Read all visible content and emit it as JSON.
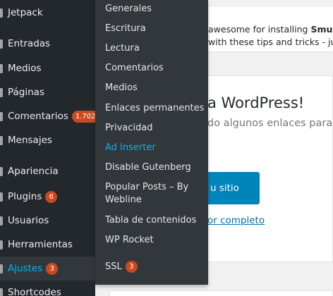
{
  "menu": {
    "items": [
      {
        "label": "Jetpack",
        "icon": "jetpack-icon"
      },
      {
        "label": "Entradas",
        "icon": "pin-icon"
      },
      {
        "label": "Medios",
        "icon": "media-icon"
      },
      {
        "label": "Páginas",
        "icon": "page-icon"
      },
      {
        "label": "Comentarios",
        "icon": "comment-icon",
        "badge": "1.702"
      },
      {
        "label": "Mensajes",
        "icon": "email-icon"
      },
      {
        "label": "Apariencia",
        "icon": "brush-icon"
      },
      {
        "label": "Plugins",
        "icon": "plugin-icon",
        "badge": "6"
      },
      {
        "label": "Usuarios",
        "icon": "users-icon"
      },
      {
        "label": "Herramientas",
        "icon": "wrench-icon"
      },
      {
        "label": "Ajustes",
        "icon": "settings-icon",
        "badge": "3",
        "current": true
      },
      {
        "label": "Shortcodes",
        "icon": "shortcode-icon"
      }
    ]
  },
  "submenu": {
    "items": [
      {
        "label": "Generales"
      },
      {
        "label": "Escritura"
      },
      {
        "label": "Lectura"
      },
      {
        "label": "Comentarios"
      },
      {
        "label": "Medios"
      },
      {
        "label": "Enlaces permanentes"
      },
      {
        "label": "Privacidad"
      },
      {
        "label": "Ad Inserter",
        "highlight": true
      },
      {
        "label": "Disable Gutenberg"
      },
      {
        "label": "Popular Posts – By",
        "line2": "Webline"
      },
      {
        "label": "Tabla de contenidos"
      },
      {
        "label": "WP Rocket"
      },
      {
        "label": "SSL",
        "badge": "3"
      }
    ]
  },
  "content": {
    "notice_line1_prefix": "awesome for installing ",
    "notice_line1_bold": "Smush",
    "notice_line2": "with these tips and tricks - just",
    "welcome_title": "a WordPress!",
    "welcome_subtitle": "do algunos enlaces para c",
    "button_label": "u sitio",
    "dismiss_link": "or completo"
  },
  "colors": {
    "menu_bg": "#23282d",
    "submenu_bg": "#32373c",
    "accent": "#00b9eb",
    "badge": "#ca4a1f",
    "primary_button": "#0085ba"
  }
}
